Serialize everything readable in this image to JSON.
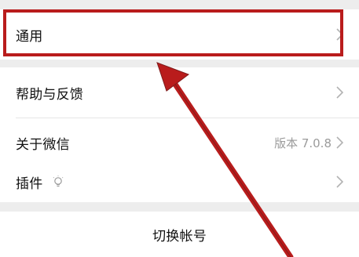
{
  "settings": {
    "items": [
      {
        "label": "通用"
      },
      {
        "label": "帮助与反馈"
      },
      {
        "label": "关于微信",
        "value": "版本 7.0.8"
      },
      {
        "label": "插件"
      }
    ],
    "switch_account": "切换帐号"
  },
  "colors": {
    "annotation": "#b91c1c",
    "chevron": "#b2b2b2",
    "background": "#ededed"
  },
  "icons": {
    "chevron": "chevron-right-icon",
    "plugin": "lightbulb-icon"
  }
}
